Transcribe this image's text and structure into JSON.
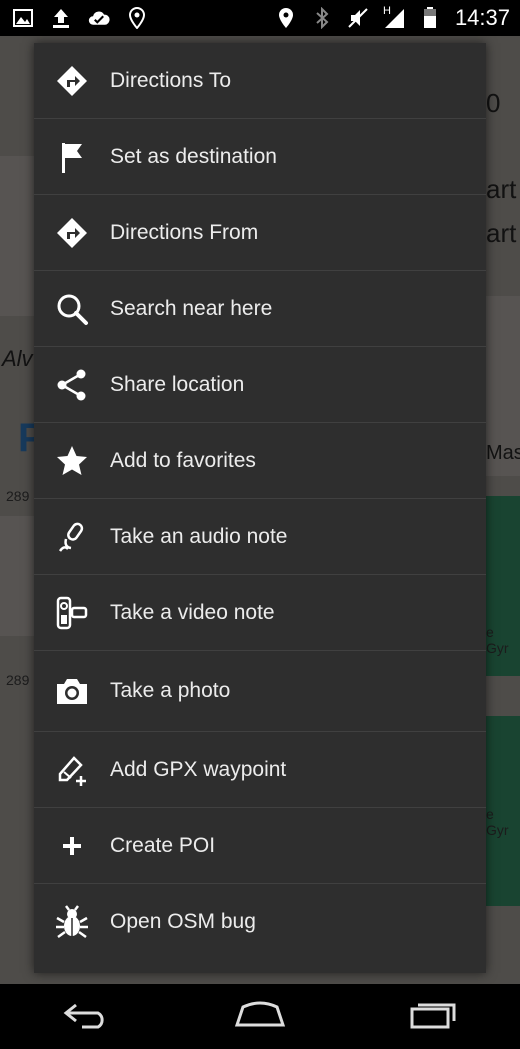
{
  "status_bar": {
    "time": "14:37",
    "left_icons": [
      "image-icon",
      "upload-icon",
      "cloud-check-icon",
      "location-pin-icon"
    ],
    "right_icons": [
      "location-icon",
      "bluetooth-icon",
      "mute-icon",
      "signal-icon",
      "battery-icon"
    ],
    "network_label": "H"
  },
  "map": {
    "labels": [
      "Alv",
      "P",
      "art",
      "art",
      "Mast",
      "e Gyr",
      "e Gyr",
      "289",
      "289",
      "0"
    ]
  },
  "menu": {
    "items": [
      {
        "label": "Directions To",
        "icon": "directions-icon"
      },
      {
        "label": "Set as destination",
        "icon": "flag-icon"
      },
      {
        "label": "Directions From",
        "icon": "directions-icon"
      },
      {
        "label": "Search near here",
        "icon": "search-icon"
      },
      {
        "label": "Share location",
        "icon": "share-icon"
      },
      {
        "label": "Add to favorites",
        "icon": "star-icon"
      },
      {
        "label": "Take an audio note",
        "icon": "microphone-icon"
      },
      {
        "label": "Take a video note",
        "icon": "video-camera-icon"
      },
      {
        "label": "Take a photo",
        "icon": "camera-icon"
      },
      {
        "label": "Add GPX waypoint",
        "icon": "waypoint-add-icon"
      },
      {
        "label": "Create POI",
        "icon": "plus-icon"
      },
      {
        "label": "Open OSM bug",
        "icon": "bug-icon"
      }
    ]
  },
  "navbar": {
    "buttons": [
      "back-icon",
      "home-icon",
      "recents-icon"
    ]
  }
}
